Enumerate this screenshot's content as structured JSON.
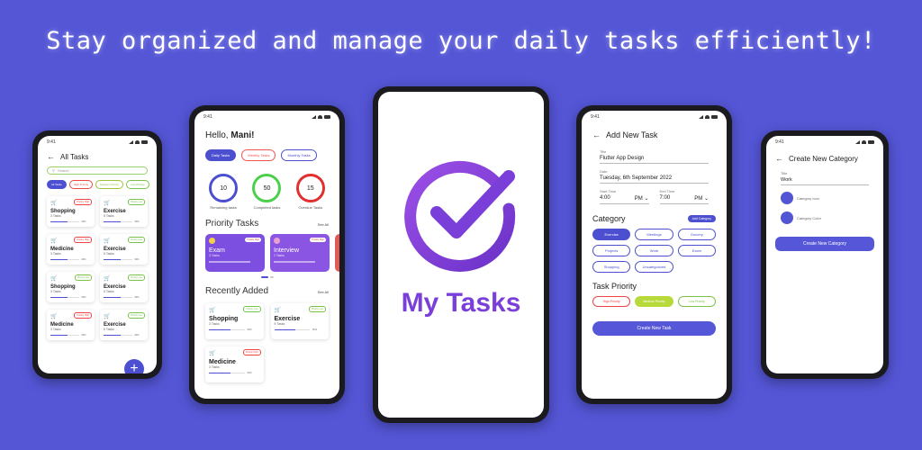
{
  "banner": {
    "title": "Stay organized and manage your daily tasks efficiently!"
  },
  "colors": {
    "background": "#5456d6",
    "primary": "#4c4fd0",
    "logo": "#7b3fd9"
  },
  "status_time": "9:41",
  "all_tasks": {
    "title": "All Tasks",
    "search_placeholder": "Search",
    "chips": [
      {
        "label": "All Tasks",
        "active": true
      },
      {
        "label": "High Priority"
      },
      {
        "label": "Medium Priority"
      },
      {
        "label": "Low Priority"
      }
    ],
    "cards": [
      {
        "name": "Shopping",
        "count": "3 Tasks",
        "tag": "Priority High",
        "progress": "60%"
      },
      {
        "name": "Exercise",
        "count": "5 Tasks",
        "tag": "Priority Low",
        "progress": "60%"
      },
      {
        "name": "Medicine",
        "count": "3 Tasks",
        "tag": "Priority High",
        "progress": "60%"
      },
      {
        "name": "Exercise",
        "count": "5 Tasks",
        "tag": "Priority Low",
        "progress": "60%"
      },
      {
        "name": "Shopping",
        "count": "3 Tasks",
        "tag": "Priority Low",
        "progress": "60%"
      },
      {
        "name": "Exercise",
        "count": "5 Tasks",
        "tag": "Priority Low",
        "progress": "60%"
      },
      {
        "name": "Medicine",
        "count": "3 Tasks",
        "tag": "Priority High",
        "progress": "60%"
      },
      {
        "name": "Exercise",
        "count": "5 Tasks",
        "tag": "Priority Low",
        "progress": "60%"
      }
    ],
    "fab": "+"
  },
  "home": {
    "greeting": "Hello, ",
    "user": "Mani!",
    "tabs": [
      "Daily Tasks",
      "Weekly Tasks",
      "Monthly Tasks"
    ],
    "stats": [
      {
        "value": "10",
        "label": "Remaining tasks",
        "color": "#4c4fd0"
      },
      {
        "value": "50",
        "label": "Completed tasks",
        "color": "#4cd04c"
      },
      {
        "value": "15",
        "label": "Overdue Tasks",
        "color": "#e03030"
      }
    ],
    "priority_title": "Priority Tasks",
    "see_all": "See All",
    "priority_cards": [
      {
        "name": "Exam",
        "count": "3 Tasks",
        "tag": "Priority High",
        "progress": "60%"
      },
      {
        "name": "Interview",
        "count": "1 Tasks",
        "tag": "Priority High",
        "progress": "60%"
      }
    ],
    "recent_title": "Recently Added",
    "recent_cards": [
      {
        "name": "Shopping",
        "count": "3 Tasks",
        "tag": "Priority Low",
        "progress": "60%"
      },
      {
        "name": "Exercise",
        "count": "5 Tasks",
        "tag": "Priority Low",
        "progress": "60%"
      },
      {
        "name": "Medicine",
        "count": "3 Tasks",
        "tag": "Priority High",
        "progress": "60%"
      }
    ]
  },
  "logo": {
    "title": "My Tasks"
  },
  "add_task": {
    "title": "Add New Task",
    "title_label": "Title",
    "title_value": "Flutter App Design",
    "date_label": "Date",
    "date_value": "Tuesday, 6th September 2022",
    "start_label": "Start Time",
    "start_value": "4:00",
    "start_ampm": "PM",
    "end_label": "End Time",
    "end_value": "7:00",
    "end_ampm": "PM",
    "category_title": "Category",
    "add_category": "Add Category",
    "categories": [
      "Exercise",
      "Meetings",
      "Grocery",
      "Projects",
      "Work",
      "Exam",
      "Shopping",
      "Uncategorized"
    ],
    "priority_title": "Task Priority",
    "priorities": [
      "High Priority",
      "Medium Priority",
      "Low Priority"
    ],
    "create_label": "Create New Task"
  },
  "new_category": {
    "title": "Create New Category",
    "title_label": "Title",
    "title_value": "Work",
    "icon_label": "Category Icon",
    "color_label": "Category Color",
    "create_label": "Create New Category"
  }
}
